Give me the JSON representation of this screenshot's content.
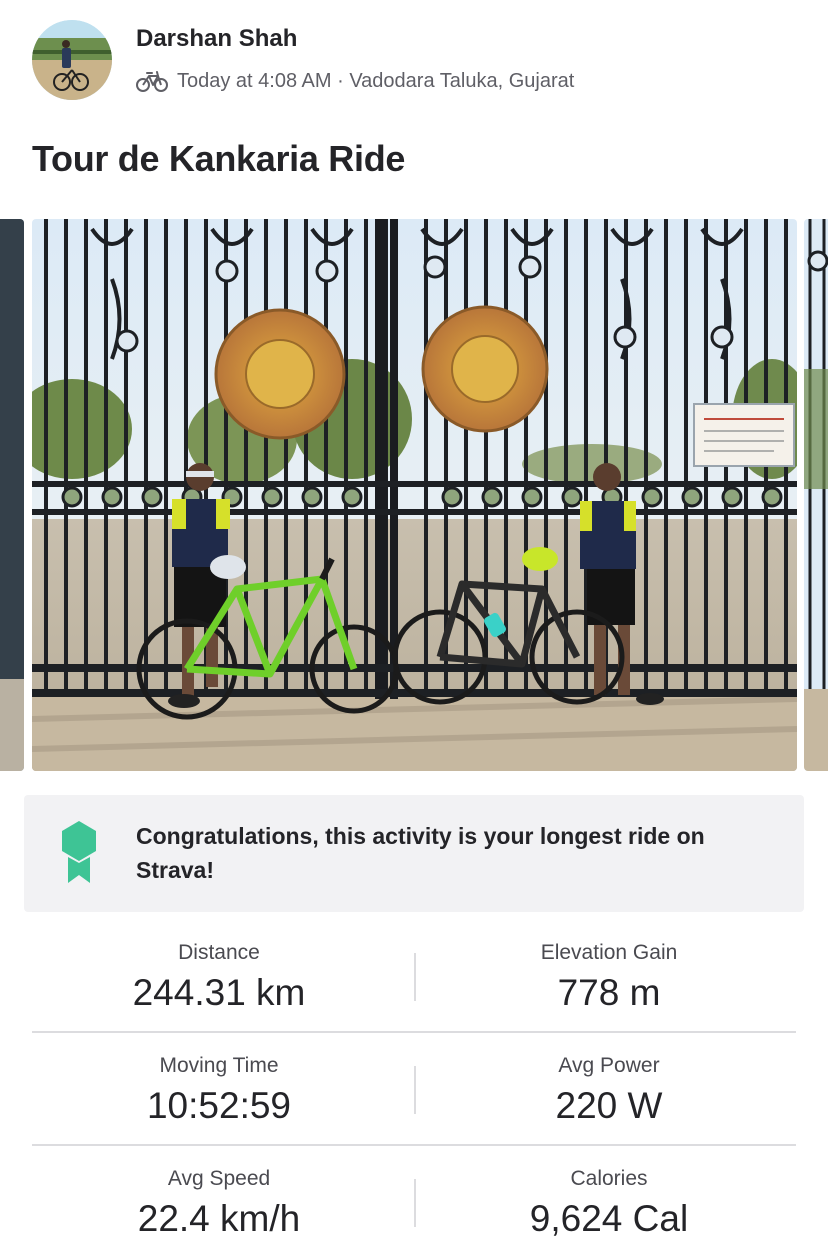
{
  "header": {
    "author_name": "Darshan Shah",
    "timestamp": "Today at 4:08 AM",
    "separator": " · ",
    "location": "Vadodara Taluka, Gujarat",
    "activity_icon": "bike-icon"
  },
  "activity": {
    "title": "Tour de Kankaria Ride"
  },
  "achievement": {
    "icon": "award-ribbon-icon",
    "message": "Congratulations, this activity is your longest ride on Strava!",
    "accent_color": "#3ec495"
  },
  "stats": [
    {
      "label": "Distance",
      "value": "244.31 km"
    },
    {
      "label": "Elevation Gain",
      "value": "778 m"
    },
    {
      "label": "Moving Time",
      "value": "10:52:59"
    },
    {
      "label": "Avg Power",
      "value": "220 W"
    },
    {
      "label": "Avg Speed",
      "value": "22.4 km/h"
    },
    {
      "label": "Calories",
      "value": "9,624 Cal"
    }
  ]
}
